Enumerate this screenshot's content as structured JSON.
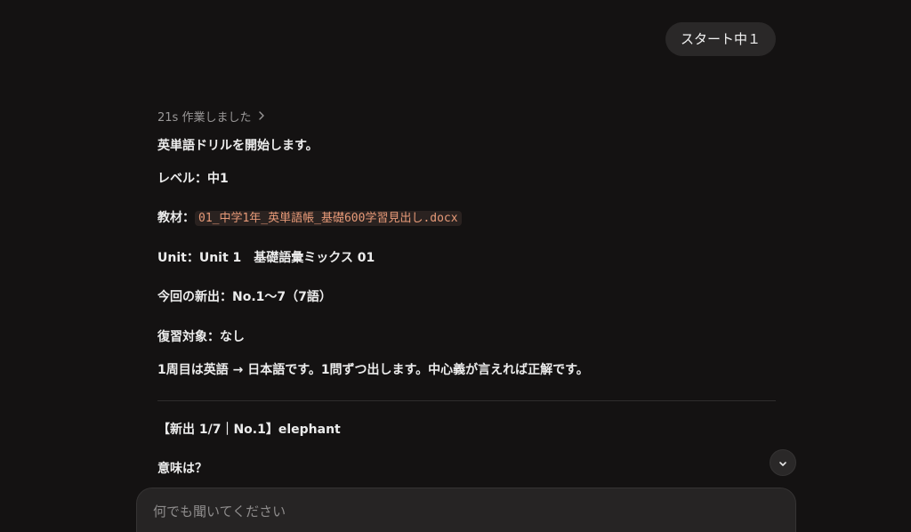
{
  "user_message": "スタート中１",
  "assistant": {
    "thought_label": "21s 作業しました",
    "lines": {
      "intro": "英単語ドリルを開始します。",
      "level": "レベル：中1",
      "material_prefix": "教材：",
      "material_file": "01_中学1年_英単語帳_基礎600学習見出し.docx",
      "unit": "Unit：Unit 1　基礎語彙ミックス 01",
      "new_items": "今回の新出：No.1〜7（7語）",
      "review": "復習対象：なし",
      "instructions": "1周目は英語 → 日本語です。1問ずつ出します。中心義が言えれば正解です。",
      "question_header": "【新出 1/7｜No.1】elephant",
      "question_prompt": "意味は？"
    }
  },
  "composer": {
    "placeholder": "何でも聞いてください"
  },
  "icons": {
    "thought_chevron": "chevron-right-icon",
    "scroll_down": "chevron-down-icon"
  },
  "colors": {
    "background": "#141212",
    "bubble": "#2a2828",
    "code_text": "#e89a78"
  }
}
